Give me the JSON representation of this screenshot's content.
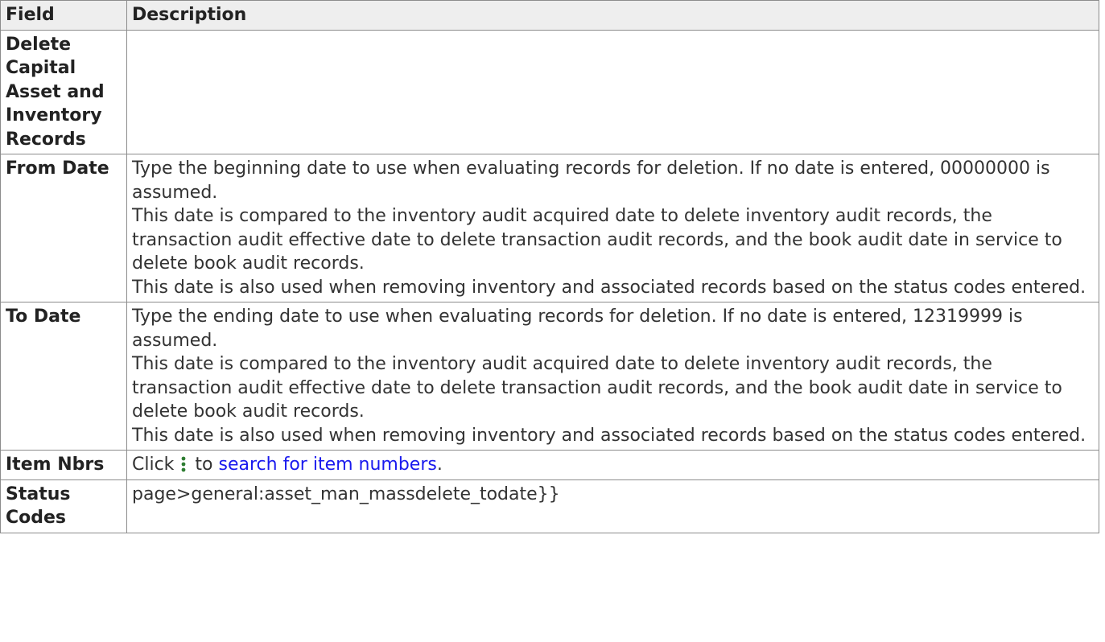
{
  "table": {
    "headers": {
      "field": "Field",
      "description": "Description"
    },
    "section_title": "Delete Capital Asset and Inventory Records",
    "rows": [
      {
        "field": "From Date",
        "paragraphs": [
          "Type the beginning date to use when evaluating records for deletion. If no date is entered, 00000000 is assumed.",
          "This date is compared to the inventory audit acquired date to delete inventory audit records, the transaction audit effective date to delete transaction audit records, and the book audit date in service to delete book audit records.",
          "This date is also used when removing inventory and associated records based on the status codes entered."
        ]
      },
      {
        "field": "To Date",
        "paragraphs": [
          "Type the ending date to use when evaluating records for deletion. If no date is entered, 12319999 is assumed.",
          "This date is compared to the inventory audit acquired date to delete inventory audit records, the transaction audit effective date to delete transaction audit records, and the book audit date in service to delete book audit records.",
          "This date is also used when removing inventory and associated records based on the status codes entered."
        ]
      },
      {
        "field": "Item Nbrs",
        "click_prefix": "Click",
        "click_middle": "to",
        "link_text": "search for item numbers",
        "suffix": ".",
        "icon": "vertical-dots-icon"
      },
      {
        "field": "Status Codes",
        "text": "page>general:asset_man_massdelete_todate}}"
      }
    ]
  },
  "colors": {
    "link": "#1a1aee",
    "header_bg": "#eeeeee",
    "icon": "#2e7d32"
  }
}
